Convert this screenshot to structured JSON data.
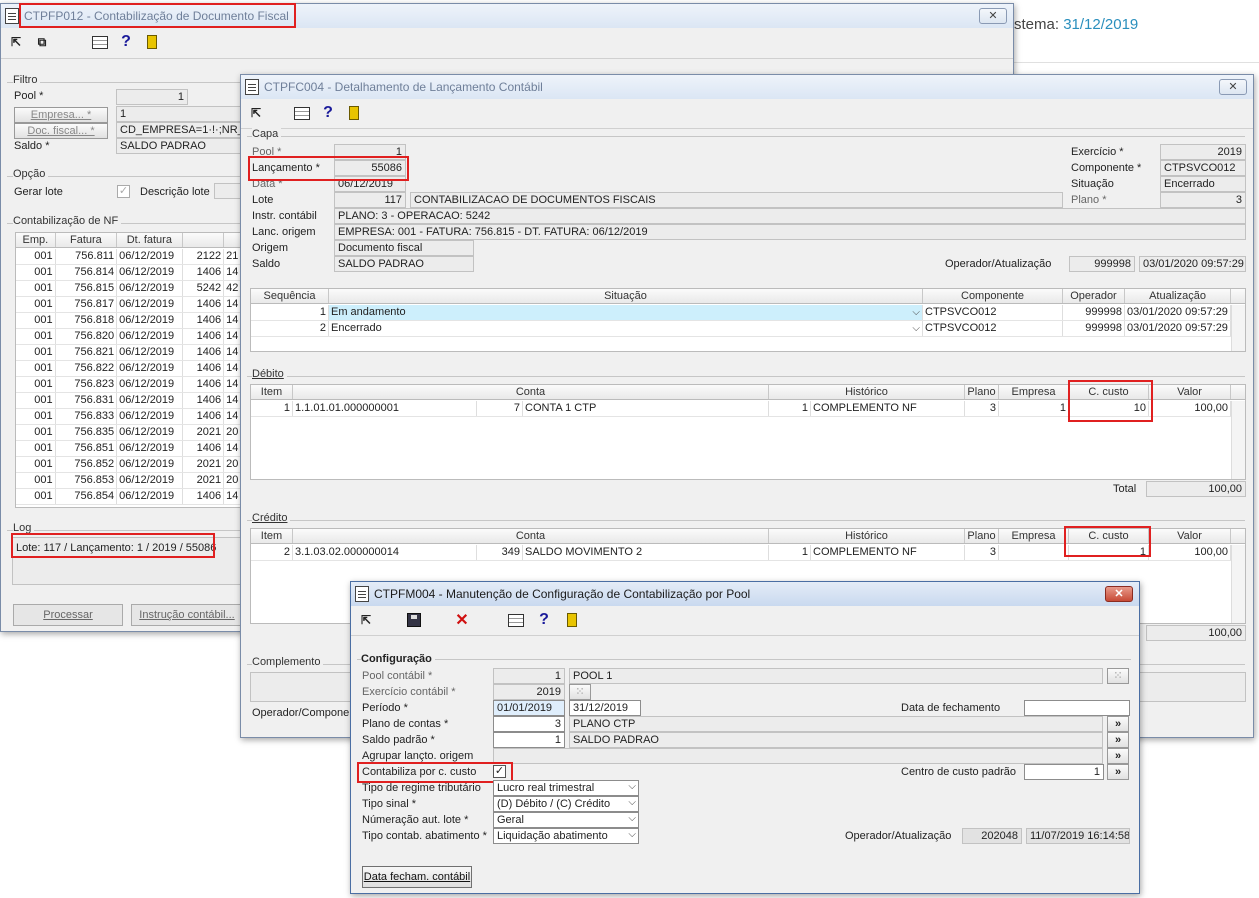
{
  "background": {
    "sistema_label": "stema:",
    "sistema_date": "31/12/2019",
    "accent": "#2a8fbd"
  },
  "w1": {
    "title": "CTPFP012 - Contabilização de Documento Fiscal",
    "close": "✕",
    "filtro": {
      "legend": "Filtro",
      "pool_label": "Pool *",
      "pool_value": "1",
      "empresa_btn": "Empresa... *",
      "empresa_value": "1",
      "doc_btn": "Doc. fiscal... *",
      "doc_value": "CD_EMPRESA=1·!·;NR_FA",
      "saldo_label": "Saldo *",
      "saldo_value": "SALDO PADRAO"
    },
    "opcao": {
      "legend": "Opção",
      "gerar_lote": "Gerar lote",
      "descricao_lote": "Descrição lote"
    },
    "nf": {
      "legend": "Contabilização de NF",
      "headers": [
        "Emp.",
        "Fatura",
        "Dt. fatura",
        "",
        ""
      ],
      "rows": [
        [
          "001",
          "756.811",
          "06/12/2019",
          "2122",
          "21"
        ],
        [
          "001",
          "756.814",
          "06/12/2019",
          "1406",
          "14"
        ],
        [
          "001",
          "756.815",
          "06/12/2019",
          "5242",
          "42"
        ],
        [
          "001",
          "756.817",
          "06/12/2019",
          "1406",
          "14"
        ],
        [
          "001",
          "756.818",
          "06/12/2019",
          "1406",
          "14"
        ],
        [
          "001",
          "756.820",
          "06/12/2019",
          "1406",
          "14"
        ],
        [
          "001",
          "756.821",
          "06/12/2019",
          "1406",
          "14"
        ],
        [
          "001",
          "756.822",
          "06/12/2019",
          "1406",
          "14"
        ],
        [
          "001",
          "756.823",
          "06/12/2019",
          "1406",
          "14"
        ],
        [
          "001",
          "756.831",
          "06/12/2019",
          "1406",
          "14"
        ],
        [
          "001",
          "756.833",
          "06/12/2019",
          "1406",
          "14"
        ],
        [
          "001",
          "756.835",
          "06/12/2019",
          "2021",
          "20"
        ],
        [
          "001",
          "756.851",
          "06/12/2019",
          "1406",
          "14"
        ],
        [
          "001",
          "756.852",
          "06/12/2019",
          "2021",
          "20"
        ],
        [
          "001",
          "756.853",
          "06/12/2019",
          "2021",
          "20"
        ],
        [
          "001",
          "756.854",
          "06/12/2019",
          "1406",
          "14"
        ]
      ]
    },
    "log": {
      "legend": "Log",
      "text": "Lote: 117 / Lançamento: 1 / 2019 / 55086"
    },
    "btn_processar": "Processar",
    "btn_instrucao": "Instrução contábil..."
  },
  "w2": {
    "title": "CTPFC004 - Detalhamento de Lançamento Contábil",
    "close": "✕",
    "capa": {
      "legend": "Capa",
      "pool_label": "Pool *",
      "pool_value": "1",
      "lanc_label": "Lançamento *",
      "lanc_value": "55086",
      "data_label": "Data *",
      "data_value": "06/12/2019",
      "lote_label": "Lote",
      "lote_value": "117",
      "lote_desc": "CONTABILIZACAO DE DOCUMENTOS FISCAIS",
      "instr_label": "Instr. contábil",
      "instr_value": "PLANO: 3 - OPERACAO: 5242",
      "lanc_origem_label": "Lanc. origem",
      "lanc_origem_value": "EMPRESA: 001 - FATURA: 756.815 - DT. FATURA: 06/12/2019",
      "origem_label": "Origem",
      "origem_value": "Documento fiscal",
      "saldo_label": "Saldo",
      "saldo_value": "SALDO PADRAO",
      "exercicio_label": "Exercício *",
      "exercicio_value": "2019",
      "componente_label": "Componente *",
      "componente_value": "CTPSVCO012",
      "situacao_label": "Situação",
      "situacao_value": "Encerrado",
      "plano_label": "Plano *",
      "plano_value": "3",
      "operador_label": "Operador/Atualização",
      "operador_value": "999998",
      "atualizacao_value": "03/01/2020 09:57:29"
    },
    "seq": {
      "headers": [
        "Sequência",
        "Situação",
        "Componente",
        "Operador",
        "Atualização"
      ],
      "rows": [
        [
          "1",
          "Em andamento",
          "CTPSVCO012",
          "999998",
          "03/01/2020 09:57:29"
        ],
        [
          "2",
          "Encerrado",
          "CTPSVCO012",
          "999998",
          "03/01/2020 09:57:29"
        ]
      ]
    },
    "debito": {
      "legend": "Débito",
      "headers": [
        "Item",
        "Conta",
        "Histórico",
        "Plano",
        "Empresa",
        "C. custo",
        "Valor"
      ],
      "row": [
        "1",
        "1.1.01.01.000000001",
        "7",
        "CONTA 1 CTP",
        "1",
        "COMPLEMENTO NF",
        "3",
        "1",
        "10",
        "100,00"
      ],
      "total_label": "Total",
      "total_value": "100,00"
    },
    "credito": {
      "legend": "Crédito",
      "headers": [
        "Item",
        "Conta",
        "Histórico",
        "Plano",
        "Empresa",
        "C. custo",
        "Valor"
      ],
      "row": [
        "2",
        "3.1.03.02.000000014",
        "349",
        "SALDO MOVIMENTO 2",
        "1",
        "COMPLEMENTO NF",
        "3",
        "",
        "1",
        "100,00"
      ],
      "total_value": "100,00"
    },
    "complemento": {
      "legend": "Complemento",
      "operador_label": "Operador/Componente"
    }
  },
  "w3": {
    "title": "CTPFM004 - Manutenção de Configuração de Contabilização por Pool",
    "close": "✕",
    "config": {
      "legend": "Configuração",
      "pool_label": "Pool contábil *",
      "pool_value": "1",
      "pool_desc": "POOL 1",
      "exercicio_label": "Exercício contábil *",
      "exercicio_value": "2019",
      "periodo_label": "Período *",
      "periodo_ini": "01/01/2019",
      "periodo_fim": "31/12/2019",
      "data_fech_label": "Data de fechamento",
      "data_fech_value": "",
      "plano_label": "Plano de contas *",
      "plano_value": "3",
      "plano_desc": "PLANO CTP",
      "saldo_label": "Saldo padrão *",
      "saldo_value": "1",
      "saldo_desc": "SALDO PADRAO",
      "agrupar_label": "Agrupar lançto. origem",
      "ccusto_label": "Contabiliza por c. custo",
      "centro_label": "Centro de custo padrão",
      "centro_value": "1",
      "regime_label": "Tipo de regime tributário",
      "regime_value": "Lucro real trimestral",
      "sinal_label": "Tipo sinal *",
      "sinal_value": "(D) Débito / (C) Crédito",
      "numeracao_label": "Númeração aut. lote *",
      "numeracao_value": "Geral",
      "abatimento_label": "Tipo contab. abatimento *",
      "abatimento_value": "Liquidação abatimento",
      "operador_label": "Operador/Atualização",
      "operador_value": "202048",
      "atualizacao_value": "11/07/2019 16:14:58"
    },
    "btn_data_fecham": "Data fecham. contábil"
  },
  "icons": {
    "arrow": "⇱",
    "help": "?",
    "check": "✓",
    "lookup": "»",
    "dots": "⁙",
    "combo": "⌵",
    "del": "✕"
  }
}
